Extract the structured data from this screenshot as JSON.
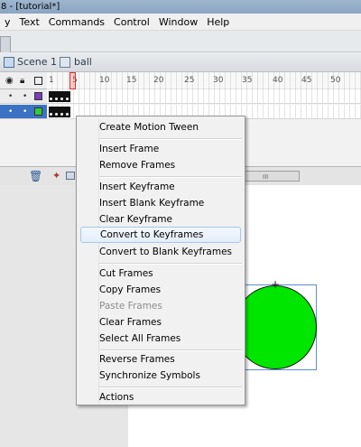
{
  "window": {
    "title": "8 - [tutorial*]"
  },
  "menubar": [
    "y",
    "Text",
    "Commands",
    "Control",
    "Window",
    "Help"
  ],
  "scene_bar": {
    "scene": "Scene 1",
    "symbol": "ball"
  },
  "timeline": {
    "ruler": [
      "1",
      "5",
      "10",
      "15",
      "20",
      "25",
      "30",
      "35",
      "40",
      "45",
      "50"
    ],
    "header_icons": {
      "eye": "eye-icon",
      "lock": "lock-icon",
      "outline": "outline-icon"
    },
    "layers": [
      {
        "visible": "•",
        "locked": "•",
        "color": "#7a3fb6",
        "selected": false
      },
      {
        "visible": "•",
        "locked": "•",
        "color": "#33cc33",
        "selected": true
      }
    ],
    "footer": {
      "trash": "trash-icon",
      "scroll_grip": "III"
    }
  },
  "context_menu": {
    "items": [
      {
        "label": "Create Motion Tween",
        "enabled": true
      },
      {
        "label": "Insert Frame",
        "enabled": true
      },
      {
        "label": "Remove Frames",
        "enabled": true
      },
      {
        "label": "Insert Keyframe",
        "enabled": true
      },
      {
        "label": "Insert Blank Keyframe",
        "enabled": true
      },
      {
        "label": "Clear Keyframe",
        "enabled": true
      },
      {
        "label": "Convert to Keyframes",
        "enabled": true,
        "highlighted": true
      },
      {
        "label": "Convert to Blank Keyframes",
        "enabled": true
      },
      {
        "label": "Cut Frames",
        "enabled": true
      },
      {
        "label": "Copy Frames",
        "enabled": true
      },
      {
        "label": "Paste Frames",
        "enabled": false
      },
      {
        "label": "Clear Frames",
        "enabled": true
      },
      {
        "label": "Select All Frames",
        "enabled": true
      },
      {
        "label": "Reverse Frames",
        "enabled": true
      },
      {
        "label": "Synchronize Symbols",
        "enabled": true
      },
      {
        "label": "Actions",
        "enabled": true
      }
    ]
  },
  "stage": {
    "ball_color": "#00e600",
    "registration_mark": "+"
  },
  "colors": {
    "highlight_border": "#a9c6ea",
    "selected_layer": "#3b72c4"
  }
}
